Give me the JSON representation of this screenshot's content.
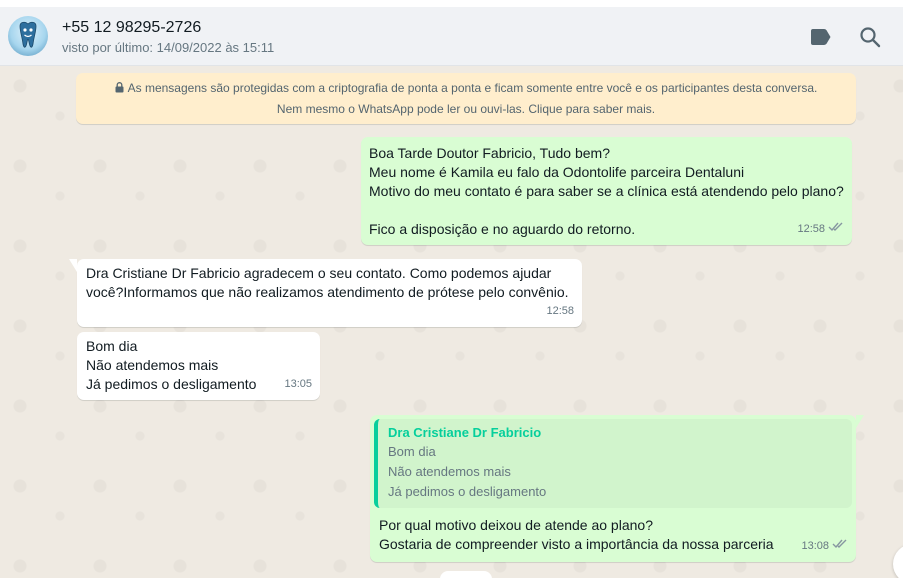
{
  "header": {
    "contact_name": "+55 12 98295-2726",
    "last_seen": "visto por último: 14/09/2022 às 15:11",
    "icons": [
      "tag-icon",
      "search-icon"
    ]
  },
  "encryption_notice": {
    "line1": "As mensagens são protegidas com a criptografia de ponta a ponta e ficam somente entre você e os participantes desta conversa.",
    "line2": "Nem mesmo o WhatsApp pode ler ou ouvi-las. Clique para saber mais."
  },
  "messages": [
    {
      "direction": "outgoing",
      "lines": [
        "Boa Tarde Doutor Fabricio, Tudo bem?",
        "Meu nome é Kamila eu falo da Odontolife parceira Dentaluni",
        "Motivo do meu contato é para saber se a clínica está atendendo pelo plano?",
        "",
        "Fico a disposição e no aguardo do retorno."
      ],
      "time": "12:58",
      "status": "read"
    },
    {
      "direction": "incoming",
      "lines": [
        "Dra Cristiane Dr Fabricio agradecem o seu contato. Como podemos ajudar",
        "você?Informamos que não realizamos atendimento de prótese pelo convênio."
      ],
      "time": "12:58"
    },
    {
      "direction": "incoming",
      "lines": [
        "Bom dia",
        "Não atendemos mais",
        "Já pedimos o desligamento"
      ],
      "time": "13:05"
    },
    {
      "direction": "outgoing",
      "quote": {
        "author": "Dra Cristiane Dr Fabricio",
        "lines": [
          "Bom dia",
          "Não atendemos mais",
          "Já pedimos o desligamento"
        ]
      },
      "lines": [
        "Por qual motivo deixou de atende ao plano?",
        "Gostaria de compreender visto a importância da nossa parceria"
      ],
      "time": "13:08",
      "status": "read"
    }
  ],
  "colors": {
    "outgoing_bubble": "#d9fdd3",
    "incoming_bubble": "#ffffff",
    "notice_bg": "#ffeecd",
    "quote_accent": "#06cf9c",
    "read_ticks": "#8696a0"
  }
}
